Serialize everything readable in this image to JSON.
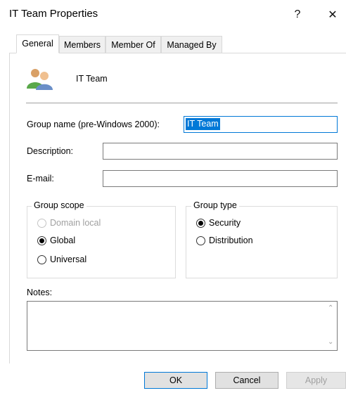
{
  "window": {
    "title": "IT Team Properties",
    "help_glyph": "?",
    "close_glyph": "✕"
  },
  "tabs": [
    {
      "label": "General",
      "active": true
    },
    {
      "label": "Members",
      "active": false
    },
    {
      "label": "Member Of",
      "active": false
    },
    {
      "label": "Managed By",
      "active": false
    }
  ],
  "header": {
    "group_display_name": "IT Team",
    "icon": "group-users-icon"
  },
  "fields": {
    "group_name_label": "Group name (pre-Windows 2000):",
    "group_name_value": "IT Team",
    "description_label": "Description:",
    "description_value": "",
    "email_label": "E-mail:",
    "email_value": ""
  },
  "group_scope": {
    "legend": "Group scope",
    "options": [
      {
        "label": "Domain local",
        "checked": false,
        "disabled": true
      },
      {
        "label": "Global",
        "checked": true,
        "disabled": false
      },
      {
        "label": "Universal",
        "checked": false,
        "disabled": false
      }
    ]
  },
  "group_type": {
    "legend": "Group type",
    "options": [
      {
        "label": "Security",
        "checked": true
      },
      {
        "label": "Distribution",
        "checked": false
      }
    ]
  },
  "notes": {
    "label": "Notes:",
    "value": ""
  },
  "buttons": {
    "ok": "OK",
    "cancel": "Cancel",
    "apply": "Apply"
  },
  "colors": {
    "accent": "#0078d7",
    "tab_inactive_bg": "#f0f0f0",
    "border": "#d9d9d9"
  }
}
